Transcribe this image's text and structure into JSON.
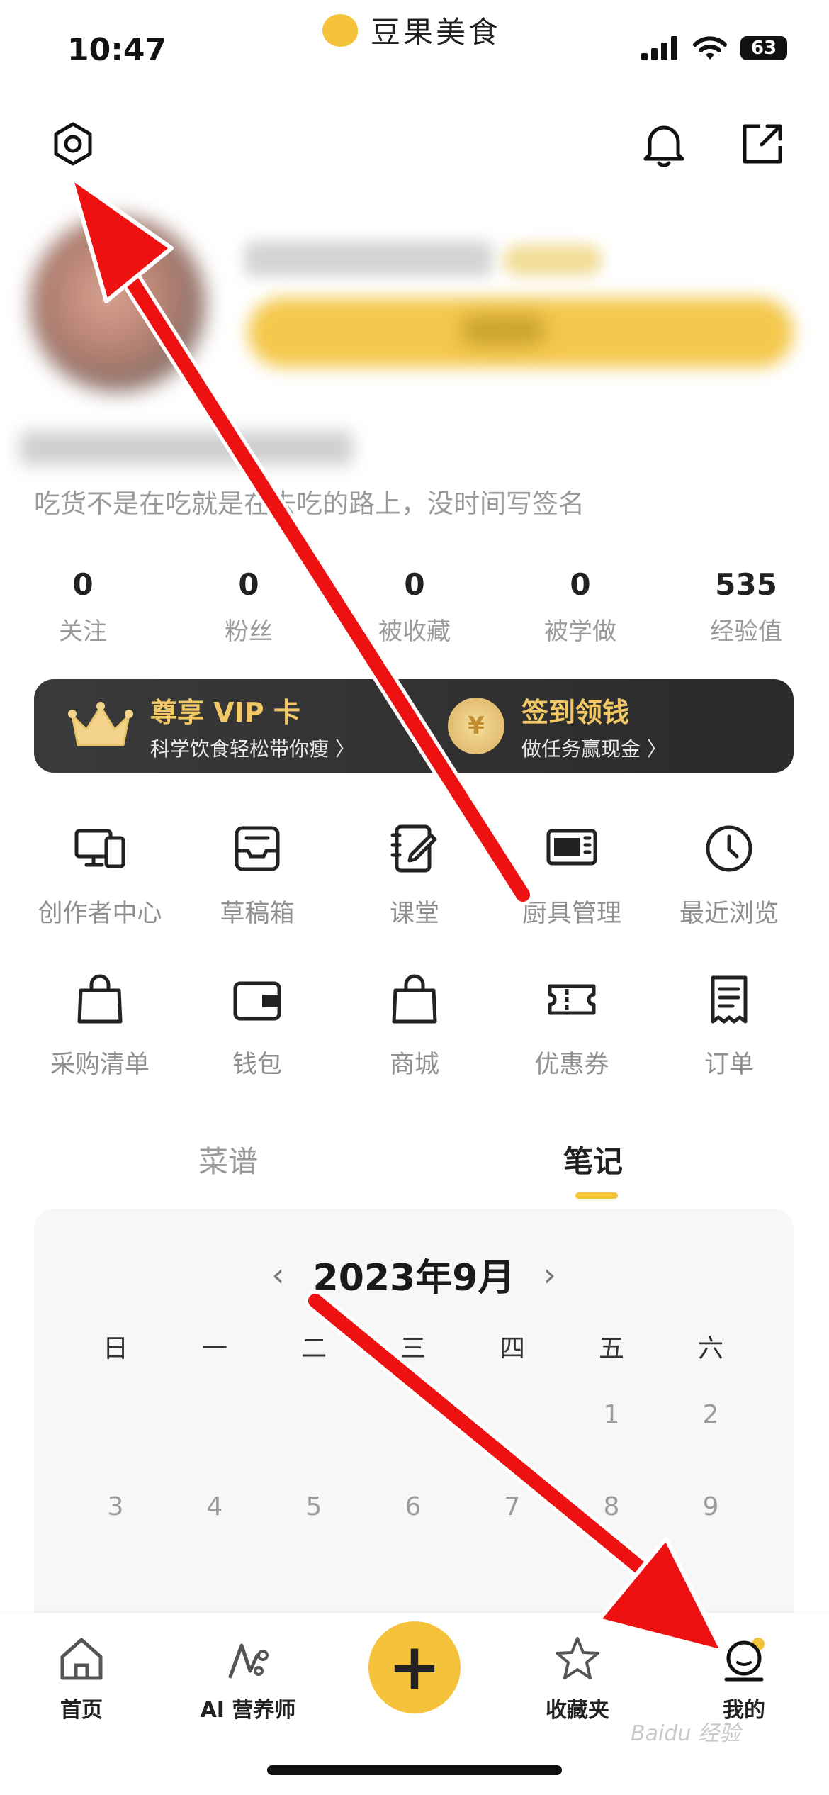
{
  "status_bar": {
    "time": "10:47",
    "app_brand": "豆果美食",
    "battery": "63"
  },
  "header": {
    "settings_icon": "gear-icon",
    "bell_icon": "bell-icon",
    "share_icon": "share-icon"
  },
  "profile": {
    "signature": "吃货不是在吃就是在去吃的路上，没时间写签名"
  },
  "stats": [
    {
      "value": "0",
      "label": "关注"
    },
    {
      "value": "0",
      "label": "粉丝"
    },
    {
      "value": "0",
      "label": "被收藏"
    },
    {
      "value": "0",
      "label": "被学做"
    },
    {
      "value": "535",
      "label": "经验值"
    }
  ],
  "banner": {
    "vip_title": "尊享 VIP 卡",
    "vip_sub": "科学饮食轻松带你瘦 〉",
    "sign_title": "签到领钱",
    "sign_sub": "做任务赢现金 〉",
    "coin_glyph": "¥"
  },
  "grid": [
    {
      "label": "创作者中心",
      "icon": "devices-icon"
    },
    {
      "label": "草稿箱",
      "icon": "inbox-icon"
    },
    {
      "label": "课堂",
      "icon": "notebook-icon"
    },
    {
      "label": "厨具管理",
      "icon": "oven-icon"
    },
    {
      "label": "最近浏览",
      "icon": "clock-icon"
    },
    {
      "label": "采购清单",
      "icon": "bag-icon"
    },
    {
      "label": "钱包",
      "icon": "wallet-icon"
    },
    {
      "label": "商城",
      "icon": "shop-bag-icon"
    },
    {
      "label": "优惠券",
      "icon": "ticket-icon"
    },
    {
      "label": "订单",
      "icon": "receipt-icon"
    }
  ],
  "tabs": {
    "recipes": "菜谱",
    "notes": "笔记"
  },
  "calendar": {
    "title": "2023年9月",
    "prev": "‹",
    "next": "›",
    "weekdays": [
      "日",
      "一",
      "二",
      "三",
      "四",
      "五",
      "六"
    ],
    "days": [
      "",
      "",
      "",
      "",
      "",
      "1",
      "2",
      "3",
      "4",
      "5",
      "6",
      "7",
      "8",
      "9"
    ]
  },
  "bottom_nav": {
    "home": "首页",
    "ai": "AI 营养师",
    "plus": "+",
    "favorites": "收藏夹",
    "mine": "我的"
  },
  "watermark": "Baidu 经验",
  "colors": {
    "accent": "#f5c33b",
    "vip_gold": "#f1c864",
    "arrow": "#ee1111"
  }
}
